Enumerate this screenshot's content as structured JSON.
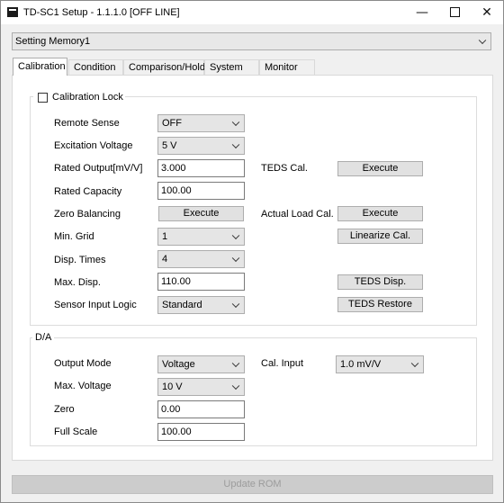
{
  "window": {
    "title": "TD-SC1 Setup - 1.1.1.0 [OFF LINE]",
    "minimize": "—",
    "close": "✕"
  },
  "memory": {
    "selected": "Setting Memory1"
  },
  "tabs": [
    {
      "label": "Calibration",
      "active": true
    },
    {
      "label": "Condition",
      "active": false
    },
    {
      "label": "Comparison/Hold",
      "active": false
    },
    {
      "label": "System",
      "active": false
    },
    {
      "label": "Monitor",
      "active": false
    }
  ],
  "calibration": {
    "lock_label": "Calibration Lock",
    "lock_checked": false,
    "remote_sense": {
      "label": "Remote Sense",
      "value": "OFF"
    },
    "excitation_voltage": {
      "label": "Excitation Voltage",
      "value": "5 V"
    },
    "rated_output": {
      "label": "Rated Output[mV/V]",
      "value": "3.000"
    },
    "rated_capacity": {
      "label": "Rated Capacity",
      "value": "100.00"
    },
    "zero_balancing": {
      "label": "Zero Balancing",
      "button": "Execute"
    },
    "min_grid": {
      "label": "Min. Grid",
      "value": "1"
    },
    "disp_times": {
      "label": "Disp. Times",
      "value": "4"
    },
    "max_disp": {
      "label": "Max. Disp.",
      "value": "110.00"
    },
    "sensor_input_logic": {
      "label": "Sensor Input Logic",
      "value": "Standard"
    },
    "teds_cal": {
      "label": "TEDS Cal.",
      "button": "Execute"
    },
    "actual_load_cal": {
      "label": "Actual Load Cal.",
      "button": "Execute"
    },
    "linearize_button": "Linearize Cal.",
    "teds_disp_button": "TEDS Disp.",
    "teds_restore_button": "TEDS Restore"
  },
  "da": {
    "title": "D/A",
    "output_mode": {
      "label": "Output Mode",
      "value": "Voltage"
    },
    "max_voltage": {
      "label": "Max. Voltage",
      "value": "10 V"
    },
    "zero": {
      "label": "Zero",
      "value": "0.00"
    },
    "full_scale": {
      "label": "Full Scale",
      "value": "100.00"
    },
    "cal_input": {
      "label": "Cal. Input",
      "value": "1.0 mV/V"
    }
  },
  "footer": {
    "update_rom": "Update ROM"
  }
}
